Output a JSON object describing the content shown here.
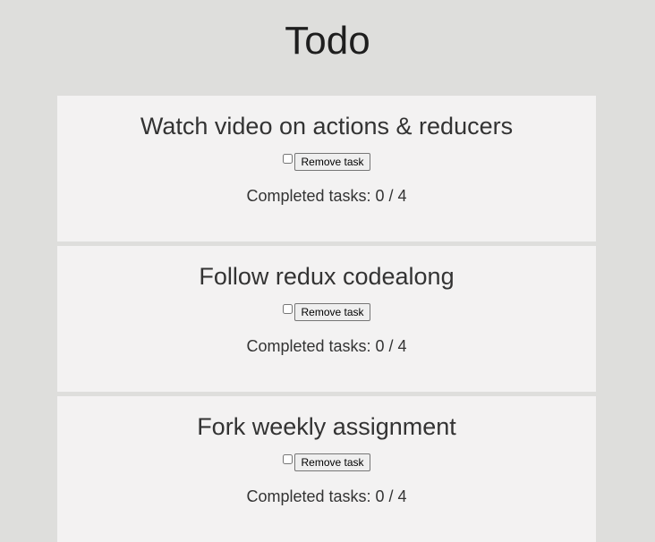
{
  "app": {
    "title": "Todo"
  },
  "todos": [
    {
      "title": "Watch video on actions & reducers",
      "remove_label": "Remove task",
      "completed_text": "Completed tasks: 0 / 4"
    },
    {
      "title": "Follow redux codealong",
      "remove_label": "Remove task",
      "completed_text": "Completed tasks: 0 / 4"
    },
    {
      "title": "Fork weekly assignment",
      "remove_label": "Remove task",
      "completed_text": "Completed tasks: 0 / 4"
    }
  ],
  "colors": {
    "page_background": "#dededc",
    "card_background": "#f3f2f2",
    "text": "#333333"
  }
}
